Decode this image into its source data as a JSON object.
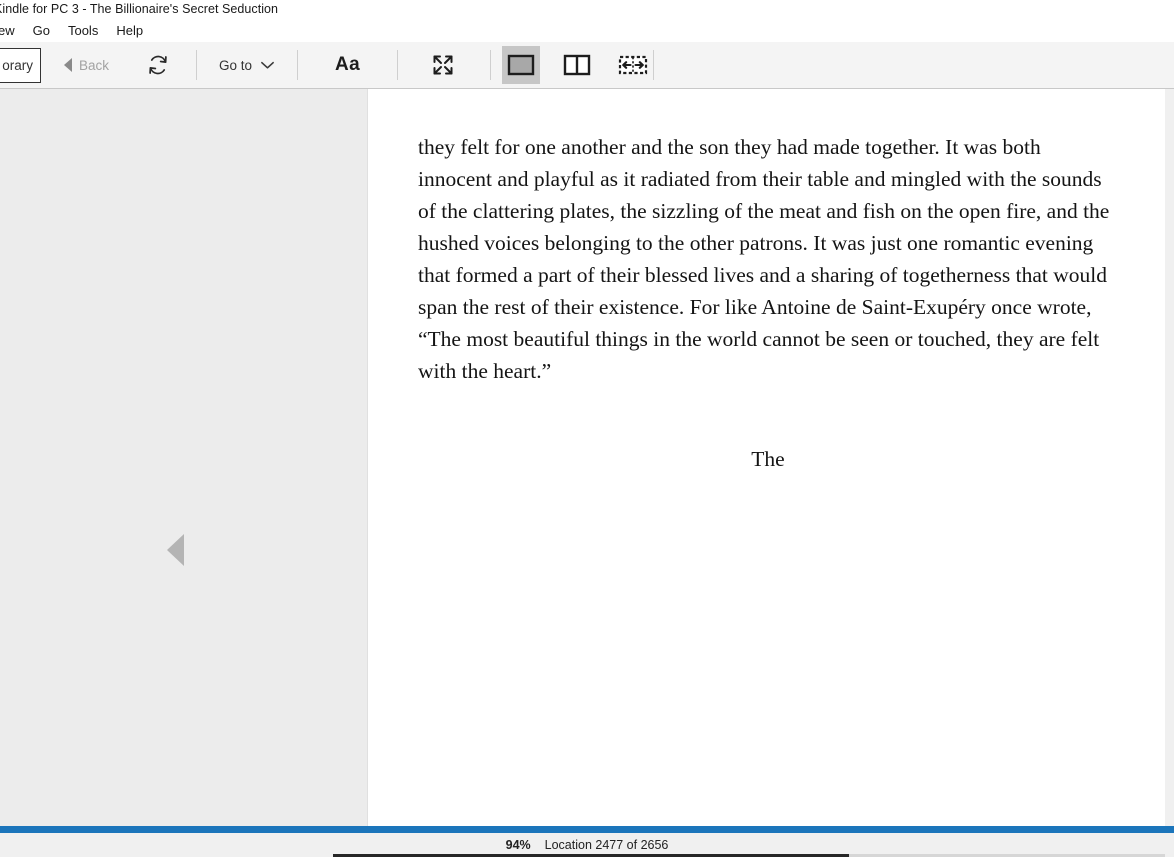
{
  "window": {
    "title": "Kindle for PC 3 - The Billionaire's Secret Seduction",
    "title_clipped_prefix": "s"
  },
  "menubar": {
    "items": [
      {
        "label": "ew",
        "name": "menu-view"
      },
      {
        "label": "Go",
        "name": "menu-go"
      },
      {
        "label": "Tools",
        "name": "menu-tools"
      },
      {
        "label": "Help",
        "name": "menu-help"
      }
    ]
  },
  "toolbar": {
    "library_label": "orary",
    "back_label": "Back",
    "back_icon": "triangle-left-icon",
    "sync_icon": "sync-refresh-icon",
    "goto_label": "Go to",
    "goto_chevron_icon": "chevron-down-icon",
    "font_label": "Aa",
    "fullscreen_icon": "expand-arrows-icon",
    "view_single_icon": "single-page-view-icon",
    "view_double_icon": "two-column-view-icon",
    "view_continuous_icon": "continuous-scroll-view-icon",
    "active_view": "single-page-view-icon"
  },
  "reader": {
    "prev_page_icon": "triangle-left-icon",
    "body_text": "they felt for one another and the son they had made together. It was both innocent and playful as it radiated from their table and mingled with the sounds of the clattering plates, the sizzling of the meat and fish on the open fire, and the hushed voices belonging to the other patrons. It was just one romantic evening that formed a part of their blessed lives and a sharing of togetherness that would span the rest of their existence. For like Antoine de Saint-Exupéry once wrote, “The most beautiful things in the world cannot be seen or touched, they are felt with the heart.”",
    "chapter_heading": "The"
  },
  "status": {
    "percent": "94%",
    "location": "Location 2477 of 2656"
  },
  "colors": {
    "accent_blue": "#1b75bb",
    "toolbar_bg": "#f4f4f4",
    "pane_bg": "#ececec",
    "page_bg": "#ffffff",
    "active_btn_bg": "#c6c6c6"
  }
}
